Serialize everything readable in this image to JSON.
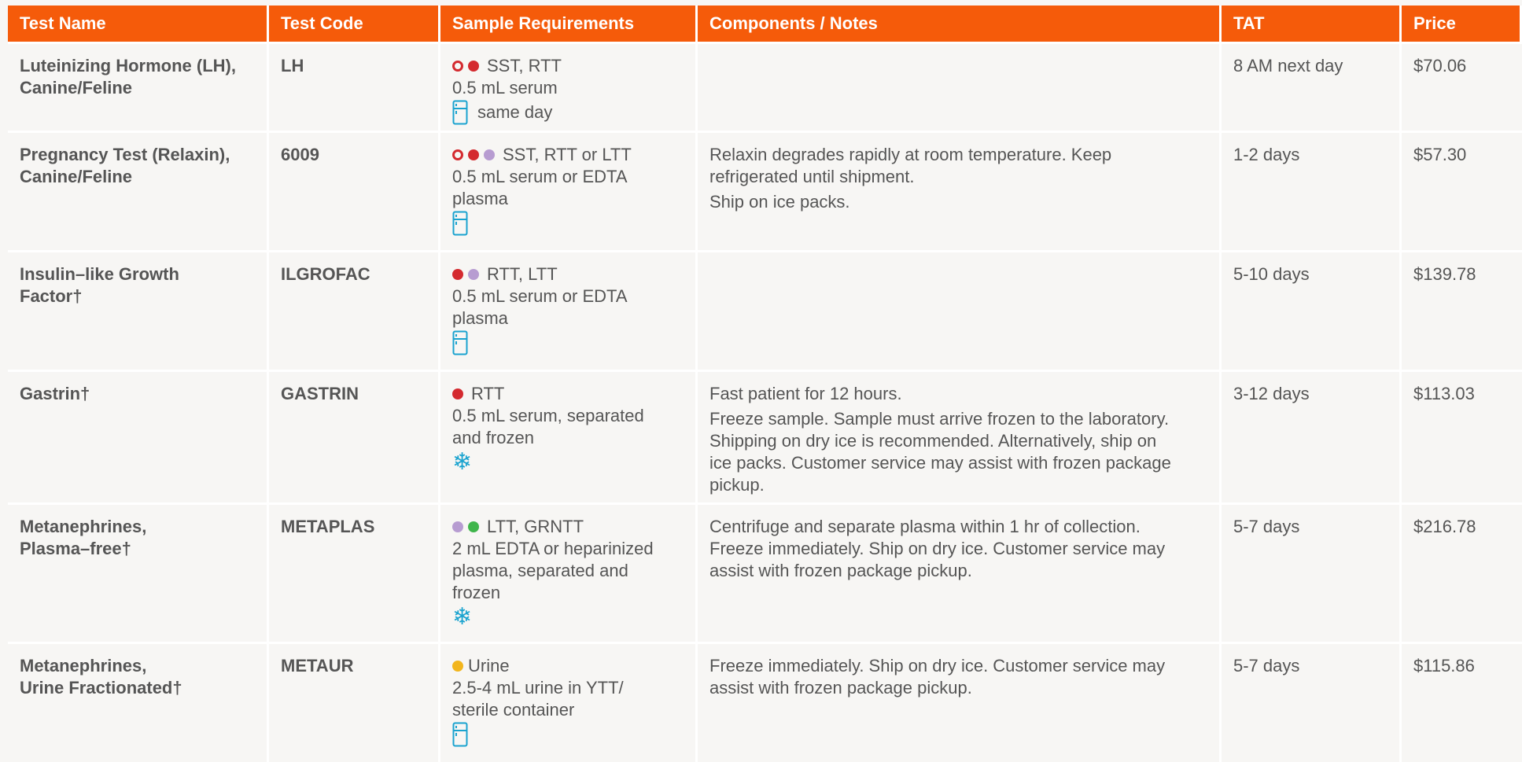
{
  "colors": {
    "header": "#f55b0a",
    "red": "#d42a2f",
    "lavender": "#b79cd1",
    "green": "#3fb54b",
    "yellow": "#f2b51c",
    "icon_blue": "#1aa3cf"
  },
  "headers": [
    "Test Name",
    "Test Code",
    "Sample Requirements",
    "Components / Notes",
    "TAT",
    "Price"
  ],
  "rows": [
    {
      "name": [
        "Luteinizing Hormone (LH),",
        "Canine/Feline"
      ],
      "code": "LH",
      "tubes": "SST, RTT",
      "volume": [
        "0.5 mL serum"
      ],
      "icon": "fridge-icon",
      "icon_text": "same day",
      "notes": [],
      "tat": "8 AM next day",
      "price": "$70.06"
    },
    {
      "name": [
        "Pregnancy Test (Relaxin),",
        "Canine/Feline"
      ],
      "code": "6009",
      "tubes": "SST, RTT or LTT",
      "volume": [
        "0.5 mL serum or EDTA",
        "plasma"
      ],
      "icon": "fridge-icon",
      "notes": [
        [
          "Relaxin degrades rapidly at room temperature. Keep",
          "refrigerated until shipment."
        ],
        [
          "Ship on ice packs."
        ]
      ],
      "tat": "1-2 days",
      "price": "$57.30"
    },
    {
      "name": [
        "Insulin–like Growth",
        "Factor†"
      ],
      "code": "ILGROFAC",
      "tubes": "RTT, LTT",
      "volume": [
        "0.5 mL serum or EDTA",
        "plasma"
      ],
      "icon": "fridge-icon",
      "notes": [],
      "tat": "5-10 days",
      "price": "$139.78"
    },
    {
      "name": [
        "Gastrin†"
      ],
      "code": "GASTRIN",
      "tubes": "RTT",
      "volume": [
        "0.5 mL serum, separated",
        "and frozen"
      ],
      "icon": "snowflake-icon",
      "notes": [
        [
          "Fast patient for 12 hours."
        ],
        [
          "Freeze sample. Sample must arrive frozen to the laboratory.",
          "Shipping on dry ice is recommended. Alternatively, ship on",
          "ice packs. Customer service may assist with frozen package",
          "pickup."
        ]
      ],
      "tat": "3-12 days",
      "price": "$113.03"
    },
    {
      "name": [
        "Metanephrines,",
        "Plasma–free†"
      ],
      "code": "METAPLAS",
      "tubes": "LTT, GRNTT",
      "volume": [
        "2 mL EDTA or heparinized",
        "plasma, separated and",
        "frozen"
      ],
      "icon": "snowflake-icon",
      "notes": [
        [
          "Centrifuge and separate plasma within 1 hr of collection.",
          "Freeze immediately. Ship on dry ice. Customer service may",
          "assist with frozen package pickup."
        ]
      ],
      "tat": "5-7 days",
      "price": "$216.78"
    },
    {
      "name": [
        "Metanephrines,",
        "Urine Fractionated†"
      ],
      "code": "METAUR",
      "tubes": "Urine",
      "volume": [
        "2.5-4 mL urine in YTT/",
        "sterile container"
      ],
      "icon": "fridge-icon",
      "notes": [
        [
          "Freeze immediately. Ship on dry ice. Customer service may",
          "assist with frozen package pickup."
        ]
      ],
      "tat": "5-7 days",
      "price": "$115.86"
    }
  ]
}
